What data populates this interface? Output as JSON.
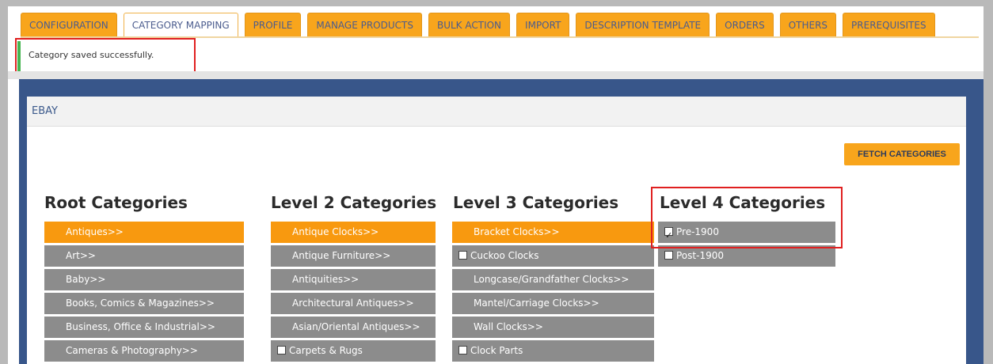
{
  "tabs": [
    {
      "label": "CONFIGURATION",
      "active": false
    },
    {
      "label": "CATEGORY MAPPING",
      "active": true
    },
    {
      "label": "PROFILE",
      "active": false
    },
    {
      "label": "MANAGE PRODUCTS",
      "active": false
    },
    {
      "label": "BULK ACTION",
      "active": false
    },
    {
      "label": "IMPORT",
      "active": false
    },
    {
      "label": "DESCRIPTION TEMPLATE",
      "active": false
    },
    {
      "label": "ORDERS",
      "active": false
    },
    {
      "label": "OTHERS",
      "active": false
    },
    {
      "label": "PREREQUISITES",
      "active": false
    }
  ],
  "notice": {
    "text": "Category saved successfully."
  },
  "panel": {
    "title": "EBAY"
  },
  "fetch_button": {
    "label": "FETCH CATEGORIES"
  },
  "columns": {
    "root": {
      "title": "Root Categories",
      "items": [
        {
          "label": "Antiques>>",
          "selected": true
        },
        {
          "label": "Art>>"
        },
        {
          "label": "Baby>>"
        },
        {
          "label": "Books, Comics & Magazines>>"
        },
        {
          "label": "Business, Office & Industrial>>"
        },
        {
          "label": "Cameras & Photography>>"
        }
      ]
    },
    "level2": {
      "title": "Level 2 Categories",
      "items": [
        {
          "label": "Antique Clocks>>",
          "selected": true
        },
        {
          "label": "Antique Furniture>>"
        },
        {
          "label": "Antiquities>>"
        },
        {
          "label": "Architectural Antiques>>"
        },
        {
          "label": "Asian/Oriental Antiques>>"
        },
        {
          "label": "Carpets & Rugs",
          "checkbox": true,
          "checked": false
        }
      ]
    },
    "level3": {
      "title": "Level 3 Categories",
      "items": [
        {
          "label": "Bracket Clocks>>",
          "selected": true
        },
        {
          "label": "Cuckoo Clocks",
          "checkbox": true,
          "checked": false
        },
        {
          "label": "Longcase/Grandfather Clocks>>"
        },
        {
          "label": "Mantel/Carriage Clocks>>"
        },
        {
          "label": "Wall Clocks>>"
        },
        {
          "label": "Clock Parts",
          "checkbox": true,
          "checked": false
        }
      ]
    },
    "level4": {
      "title": "Level 4 Categories",
      "items": [
        {
          "label": "Pre-1900",
          "checkbox": true,
          "checked": true
        },
        {
          "label": "Post-1900",
          "checkbox": true,
          "checked": false
        }
      ]
    }
  },
  "colors": {
    "accent": "#f8a51c",
    "panel_blue": "#38568a",
    "item_gray": "#8c8c8c",
    "highlight": "#e02020"
  }
}
